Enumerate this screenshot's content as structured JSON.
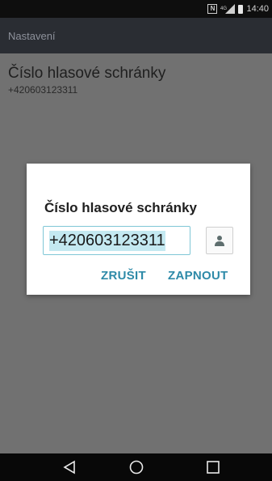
{
  "status_bar": {
    "time": "14:40",
    "icons": [
      "nfc-icon",
      "signal-icon",
      "battery-icon"
    ]
  },
  "app_bar": {
    "title": "Nastavení"
  },
  "preference": {
    "title": "Číslo hlasové schránky",
    "summary": "+420603123311"
  },
  "dialog": {
    "title": "Číslo hlasové schránky",
    "input_value": "+420603123311",
    "contact_icon": "person-icon",
    "cancel_label": "ZRUŠIT",
    "ok_label": "ZAPNOUT"
  },
  "colors": {
    "accent": "#2e8aa8",
    "status_bar": "#0e0e0e",
    "app_bar": "#2a2d33",
    "dim_background": "#717171",
    "dialog": "#ffffff"
  },
  "nav": {
    "back_icon": "back-triangle-icon",
    "home_icon": "home-circle-icon",
    "recents_icon": "recents-square-icon"
  }
}
